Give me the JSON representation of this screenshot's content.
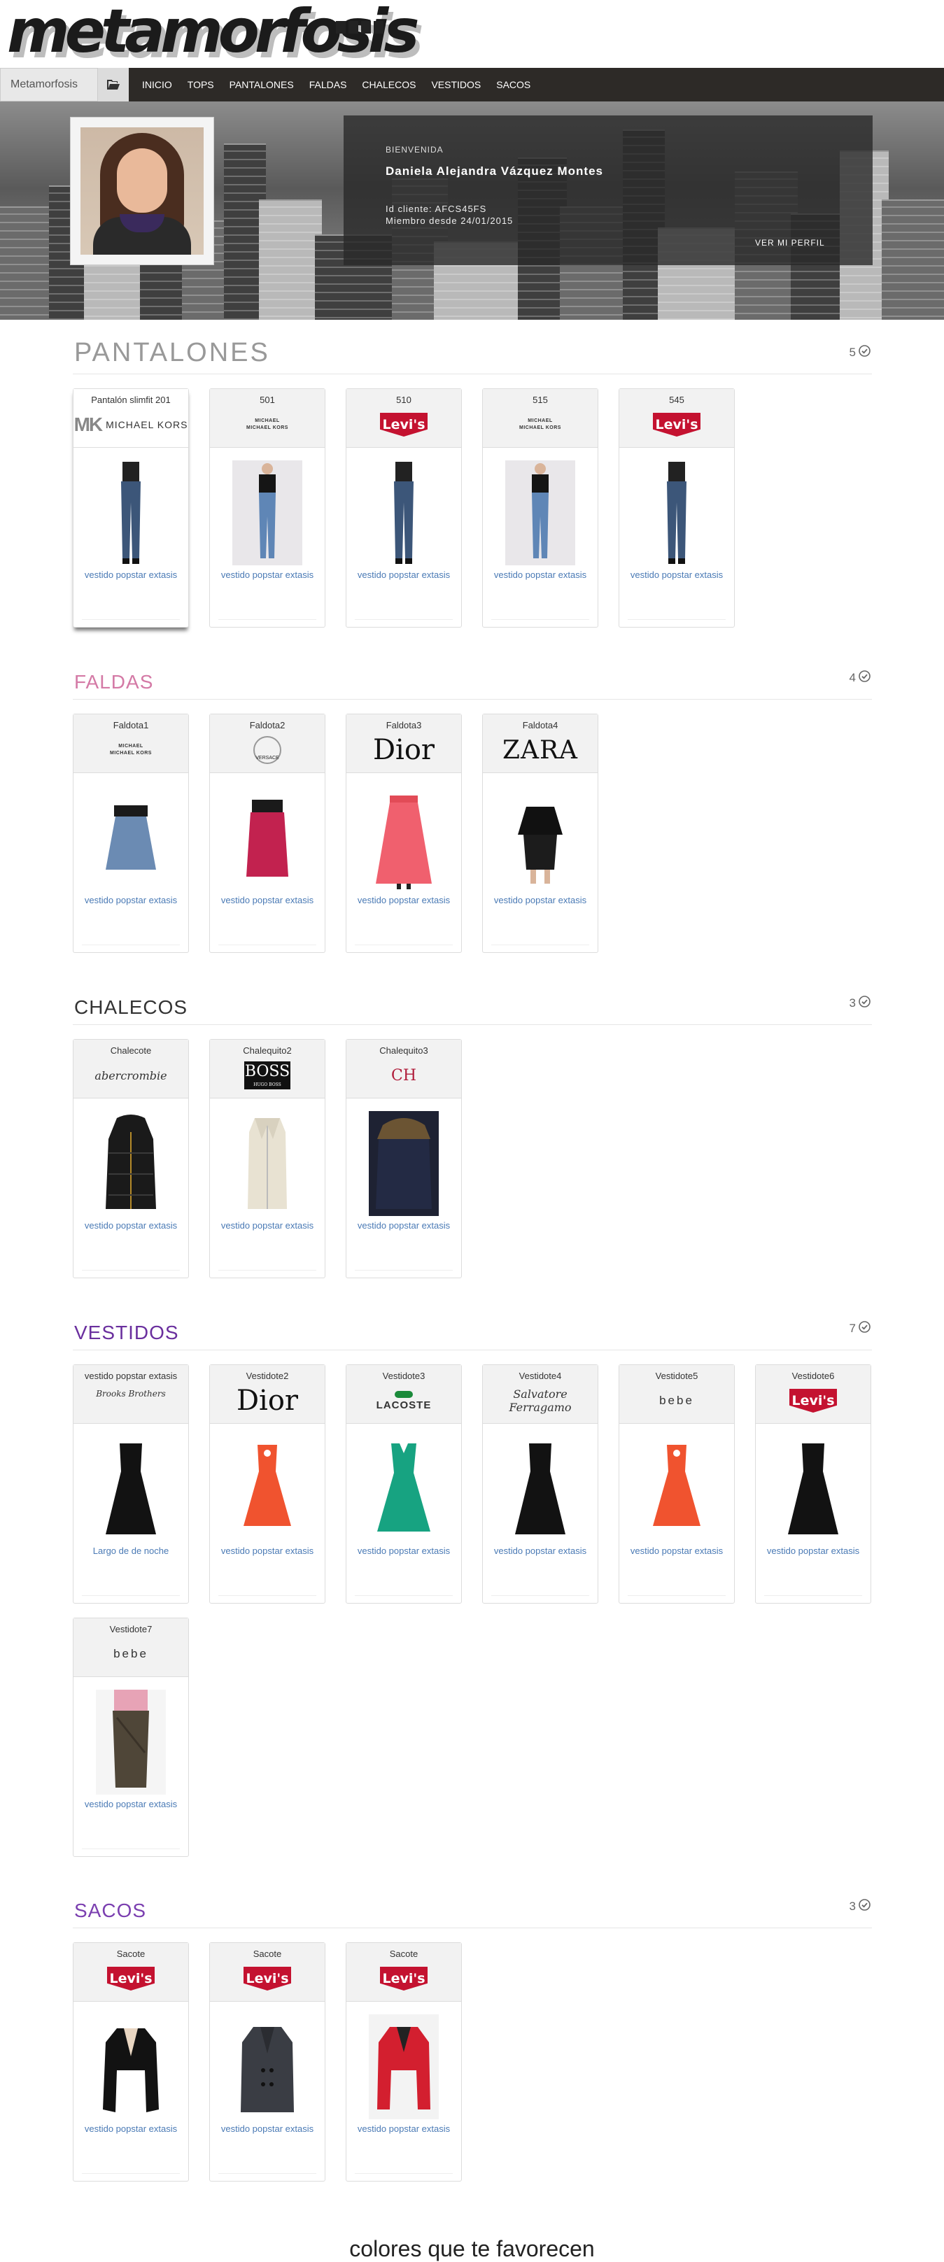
{
  "logo": {
    "text": "metamorfosis"
  },
  "nav": {
    "brand": "Metamorfosis",
    "folder_icon": "folder-open-icon",
    "links": [
      "INICIO",
      "TOPS",
      "PANTALONES",
      "FALDAS",
      "CHALECOS",
      "VESTIDOS",
      "SACOS"
    ]
  },
  "profile": {
    "welcome": "BIENVENIDA",
    "name": "Daniela Alejandra Vázquez Montes",
    "client_id": "Id cliente: AFCS45FS",
    "member_since": "Miembro desde 24/01/2015",
    "profile_link": "VER MI PERFIL"
  },
  "sections": [
    {
      "title": "PANTALONES",
      "count": "5",
      "title_color": "#999999",
      "items": [
        {
          "name": "Pantalón slimfit 201",
          "brand": "michael-kors-big",
          "desc": "vestido popstar extasis",
          "garment": "jeans",
          "active": true
        },
        {
          "name": "501",
          "brand": "michael-kors",
          "desc": "vestido popstar extasis",
          "garment": "jeans-model"
        },
        {
          "name": "510",
          "brand": "levis",
          "desc": "vestido popstar extasis",
          "garment": "jeans"
        },
        {
          "name": "515",
          "brand": "michael-kors",
          "desc": "vestido popstar extasis",
          "garment": "jeans-model"
        },
        {
          "name": "545",
          "brand": "levis",
          "desc": "vestido popstar extasis",
          "garment": "jeans"
        }
      ]
    },
    {
      "title": "FALDAS",
      "count": "4",
      "title_color": "#d47aa6",
      "items": [
        {
          "name": "Faldota1",
          "brand": "michael-kors",
          "desc": "vestido popstar extasis",
          "garment": "skirt-denim"
        },
        {
          "name": "Faldota2",
          "brand": "versace",
          "desc": "vestido popstar extasis",
          "garment": "skirt-pink"
        },
        {
          "name": "Faldota3",
          "brand": "dior",
          "desc": "vestido popstar extasis",
          "garment": "skirt-coral"
        },
        {
          "name": "Faldota4",
          "brand": "zara",
          "desc": "vestido popstar extasis",
          "garment": "skirt-black"
        }
      ]
    },
    {
      "title": "CHALECOS",
      "count": "3",
      "title_color": "#333333",
      "items": [
        {
          "name": "Chalecote",
          "brand": "abercrombie",
          "desc": "vestido popstar extasis",
          "garment": "vest-black"
        },
        {
          "name": "Chalequito2",
          "brand": "boss",
          "desc": "vestido popstar extasis",
          "garment": "vest-cream"
        },
        {
          "name": "Chalequito3",
          "brand": "ch",
          "desc": "vestido popstar extasis",
          "garment": "vest-navy"
        }
      ]
    },
    {
      "title": "VESTIDOS",
      "count": "7",
      "title_color": "#6a2f9e",
      "items": [
        {
          "name": "vestido popstar extasis",
          "brand": "brooks",
          "desc": "Largo de de noche",
          "garment": "dress-black"
        },
        {
          "name": "Vestidote2",
          "brand": "dior",
          "desc": "vestido popstar extasis",
          "garment": "dress-orange"
        },
        {
          "name": "Vestidote3",
          "brand": "lacoste",
          "desc": "vestido popstar extasis",
          "garment": "dress-green"
        },
        {
          "name": "Vestidote4",
          "brand": "ferragamo",
          "desc": "vestido popstar extasis",
          "garment": "dress-black"
        },
        {
          "name": "Vestidote5",
          "brand": "bebe",
          "desc": "vestido popstar extasis",
          "garment": "dress-orange"
        },
        {
          "name": "Vestidote6",
          "brand": "levis",
          "desc": "vestido popstar extasis",
          "garment": "dress-black"
        },
        {
          "name": "Vestidote7",
          "brand": "bebe",
          "desc": "vestido popstar extasis",
          "garment": "skirt-olive"
        }
      ]
    },
    {
      "title": "SACOS",
      "count": "3",
      "title_color": "#7b3fb0",
      "items": [
        {
          "name": "Sacote",
          "brand": "levis",
          "desc": "vestido popstar extasis",
          "garment": "jacket-black"
        },
        {
          "name": "Sacote",
          "brand": "levis",
          "desc": "vestido popstar extasis",
          "garment": "jacket-grey"
        },
        {
          "name": "Sacote",
          "brand": "levis",
          "desc": "vestido popstar extasis",
          "garment": "jacket-red"
        }
      ]
    }
  ],
  "brand_text": {
    "michael_kors": "MICHAEL\nMICHAEL KORS",
    "michael_kors_big": "MICHAEL KORS",
    "mk": "MK",
    "levis": "Levi's",
    "dior": "Dior",
    "zara": "ZARA",
    "versace": "VERSACE",
    "abercrombie": "abercrombie",
    "boss": "BOSS",
    "boss_sub": "HUGO BOSS",
    "ch": "CH",
    "lacoste": "LACOSTE",
    "bebe": "bebe",
    "brooks": "Brooks Brothers",
    "ferragamo": "Salvatore Ferragamo"
  },
  "footer": {
    "title": "colores que te favorecen"
  }
}
